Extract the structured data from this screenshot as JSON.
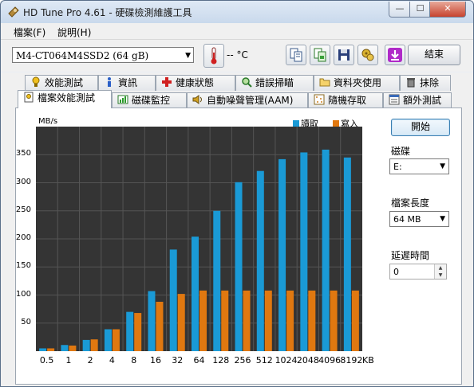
{
  "window": {
    "title": "HD Tune Pro 4.61 - 硬碟檢測維護工具"
  },
  "menu": {
    "file": "檔案(F)",
    "help": "說明(H)"
  },
  "toolbar": {
    "drive": "M4-CT064M4SSD2 (64 gB)",
    "temperature": "-- °C",
    "exit_label": "結束"
  },
  "tabs_row1": [
    {
      "label": "效能測試",
      "icon": "benchmark-icon"
    },
    {
      "label": "資訊",
      "icon": "info-icon"
    },
    {
      "label": "健康狀態",
      "icon": "health-cross-icon"
    },
    {
      "label": "錯誤掃瞄",
      "icon": "magnifier-icon"
    },
    {
      "label": "資料夾使用",
      "icon": "folder-icon"
    },
    {
      "label": "抹除",
      "icon": "trash-icon"
    }
  ],
  "tabs_row2": [
    {
      "label": "檔案效能測試",
      "icon": "file-benchmark-icon"
    },
    {
      "label": "磁碟監控",
      "icon": "monitor-icon"
    },
    {
      "label": "自動噪聲管理(AAM)",
      "icon": "speaker-icon"
    },
    {
      "label": "隨機存取",
      "icon": "random-access-icon"
    },
    {
      "label": "額外測試",
      "icon": "extra-tests-icon"
    }
  ],
  "side": {
    "start_label": "開始",
    "disk_label": "磁碟",
    "disk_value": "E:",
    "file_length_label": "檔案長度",
    "file_length_value": "64 MB",
    "delay_label": "延遲時間",
    "delay_value": "0"
  },
  "colors": {
    "read": "#1a9ad6",
    "write": "#e07810",
    "chart_bg": "#343434",
    "grid": "#555555"
  },
  "chart_data": {
    "type": "bar",
    "ylabel": "MB/s",
    "xunit": "KB",
    "ylim": [
      0,
      400
    ],
    "yticks": [
      50,
      100,
      150,
      200,
      250,
      300,
      350
    ],
    "categories": [
      "0.5",
      "1",
      "2",
      "4",
      "8",
      "16",
      "32",
      "64",
      "128",
      "256",
      "512",
      "1024",
      "2048",
      "4096",
      "8192"
    ],
    "series": [
      {
        "name": "讀取",
        "values": [
          5,
          11,
          20,
          39,
          70,
          107,
          181,
          204,
          250,
          301,
          321,
          342,
          354,
          359,
          345
        ]
      },
      {
        "name": "寫入",
        "values": [
          5,
          10,
          21,
          39,
          68,
          88,
          102,
          108,
          108,
          108,
          108,
          108,
          108,
          108,
          108
        ]
      }
    ],
    "legend_position": "top-right",
    "grid": true
  }
}
